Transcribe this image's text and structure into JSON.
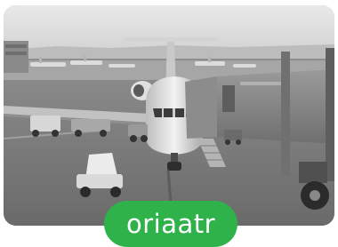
{
  "photo": {
    "subject": "airplane-at-gate",
    "tone": "grayscale"
  },
  "badge": {
    "label": "oriaatr",
    "color": "#2fb24a"
  }
}
